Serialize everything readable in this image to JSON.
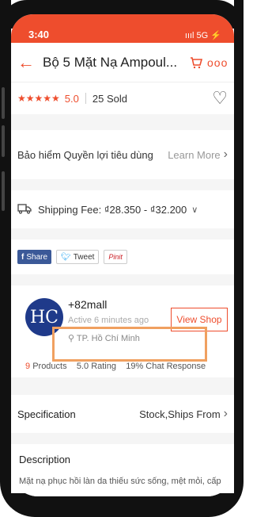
{
  "status_bar": {
    "time": "3:40",
    "signal": "ıııl 5G ⚡"
  },
  "header": {
    "title": "Bộ 5 Mặt Nạ Ampoul...",
    "back_icon": "back-arrow-icon",
    "cart_icon": "cart-icon",
    "more_icon": "more-icon"
  },
  "rating": {
    "stars": "★★★★★",
    "value": "5.0",
    "sold": "25 Sold",
    "heart_icon": "heart-icon"
  },
  "insurance": {
    "label": "Bảo hiểm Quyền lợi tiêu dùng",
    "link": "Learn More",
    "chevron": "›"
  },
  "shipping": {
    "text": "Shipping Fee: ₫28.350 - ₫32.200",
    "caret": "∨"
  },
  "share": {
    "facebook": "Share",
    "twitter": "Tweet",
    "pinterest": "Pinit"
  },
  "shop": {
    "avatar_text": "HC",
    "name": "+82mall",
    "active": "Active 6 minutes ago",
    "location": "TP. Hồ Chí Minh",
    "view_button": "View Shop",
    "products_num": "9",
    "products_label": "Products",
    "rating_text": "5.0 Rating",
    "chat_text": "19% Chat Response"
  },
  "specification": {
    "label": "Specification",
    "value": "Stock,Ships From"
  },
  "description": {
    "title": "Description",
    "text": "Mặt nạ phục hồi làn da thiếu sức sống, mệt mỏi, cấp"
  },
  "colors": {
    "accent": "#ee4d2d",
    "highlight": "#f0a060"
  }
}
